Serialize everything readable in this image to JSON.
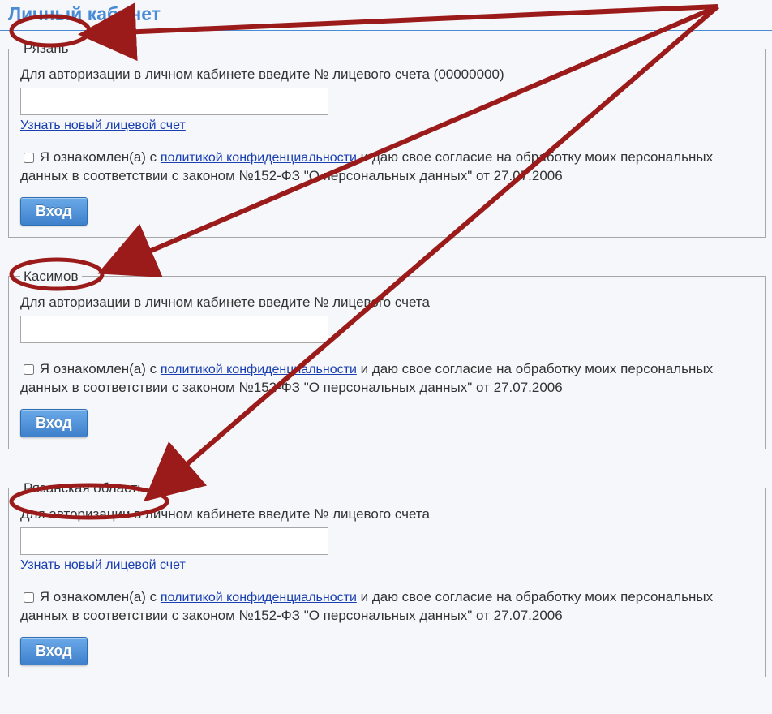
{
  "page_title": "Личный кабинет",
  "blocks": [
    {
      "legend": "Рязань",
      "instruction": "Для авторизации в личном кабинете введите № лицевого счета (00000000)",
      "account_value": "",
      "new_account_link": "Узнать новый лицевой счет",
      "consent_prefix": "Я ознакомлен(а) с ",
      "policy_link": "политикой конфиденциальности",
      "consent_suffix": " и даю свое согласие на обработку моих персональных данных в соответствии с законом №152-ФЗ \"О персональных данных\" от 27.07.2006",
      "button_label": "Вход",
      "show_new_account_link": true
    },
    {
      "legend": "Касимов",
      "instruction": "Для авторизации в личном кабинете введите № лицевого счета",
      "account_value": "",
      "new_account_link": "",
      "consent_prefix": "Я ознакомлен(а) с ",
      "policy_link": "политикой конфиденциальности",
      "consent_suffix": " и даю свое согласие на обработку моих персональных данных в соответствии с законом №152-ФЗ \"О персональных данных\" от 27.07.2006",
      "button_label": "Вход",
      "show_new_account_link": false
    },
    {
      "legend": "Рязанская область",
      "instruction": "Для авторизации в личном кабинете введите № лицевого счета",
      "account_value": "",
      "new_account_link": "Узнать новый лицевой счет",
      "consent_prefix": "Я ознакомлен(а) с ",
      "policy_link": "политикой конфиденциальности",
      "consent_suffix": " и даю свое согласие на обработку моих персональных данных в соответствии с законом №152-ФЗ \"О персональных данных\" от 27.07.2006",
      "button_label": "Вход",
      "show_new_account_link": true
    }
  ]
}
